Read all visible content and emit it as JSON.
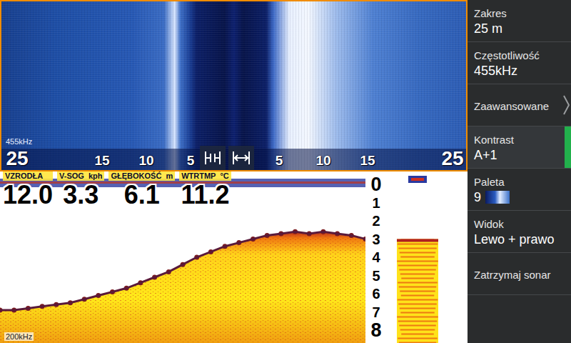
{
  "sidescan": {
    "frequency": "455kHz",
    "selected": true,
    "ticks": [
      {
        "label": "25",
        "pos": -25
      },
      {
        "label": "15",
        "pos": -15
      },
      {
        "label": "10",
        "pos": -10
      },
      {
        "label": "5",
        "pos": -5
      },
      {
        "label": "5",
        "pos": 5
      },
      {
        "label": "10",
        "pos": 10
      },
      {
        "label": "15",
        "pos": 15
      },
      {
        "label": "25",
        "pos": 25
      }
    ]
  },
  "readouts": [
    {
      "label": "VZRODŁA",
      "unit": "",
      "value": "12.0"
    },
    {
      "label": "V-SOG",
      "unit": "kph",
      "value": "3.3"
    },
    {
      "label": "GŁĘBOKOŚĆ",
      "unit": "m",
      "value": "6.1"
    },
    {
      "label": "WTRTMP",
      "unit": "°C",
      "value": "11.2"
    }
  ],
  "sonar": {
    "frequency": "200kHz",
    "depth_ticks": [
      "0",
      "1",
      "2",
      "3",
      "4",
      "5",
      "6",
      "7",
      "8"
    ],
    "bottom_depth": [
      6.9,
      6.9,
      6.8,
      6.7,
      6.6,
      6.5,
      6.3,
      6.1,
      5.9,
      5.7,
      5.4,
      5.1,
      4.8,
      4.4,
      4.0,
      3.7,
      3.4,
      3.2,
      3.0,
      2.8,
      2.7,
      2.6,
      2.7,
      2.6,
      2.7,
      2.8,
      3.0
    ]
  },
  "menu": {
    "items": [
      {
        "label": "Zakres",
        "value": "25 m",
        "kind": "value",
        "selected": false
      },
      {
        "label": "Częstotliwość",
        "value": "455kHz",
        "kind": "value",
        "selected": false
      },
      {
        "label": "Zaawansowane",
        "value": "",
        "kind": "link",
        "selected": false
      },
      {
        "label": "Kontrast",
        "value": "A+1",
        "kind": "value",
        "selected": true
      },
      {
        "label": "Paleta",
        "value": "9",
        "kind": "palette",
        "selected": false
      },
      {
        "label": "Widok",
        "value": "Lewo + prawo",
        "kind": "value",
        "selected": false
      },
      {
        "label": "Zatrzymaj sonar",
        "value": "",
        "kind": "action",
        "selected": false
      }
    ]
  }
}
